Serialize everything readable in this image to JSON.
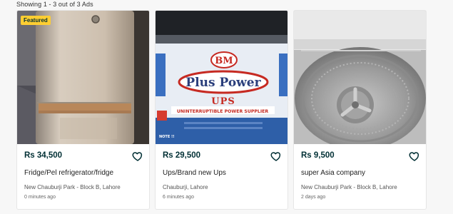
{
  "results": {
    "count_text": "Showing 1 - 3 out of 3 Ads"
  },
  "listings": [
    {
      "badge": "Featured",
      "price": "Rs 34,500",
      "title": "Fridge/Pel refrigerator/fridge",
      "location": "New Chauburji Park - Block B, Lahore",
      "posted": "0 minutes ago",
      "image": "refrigerator-photo"
    },
    {
      "price": "Rs 29,500",
      "title": "Ups/Brand new Ups",
      "location": "Chauburji, Lahore",
      "posted": "6 minutes ago",
      "image": "ups-photo",
      "image_text": {
        "brand": "BM",
        "product": "Plus Power",
        "model": "UPS",
        "tagline": "UNINTERRUPTIBLE POWER SUPPLIER",
        "note": "NOTE !!"
      }
    },
    {
      "price": "Rs 9,500",
      "title": "super Asia company",
      "location": "New Chauburji Park - Block B, Lahore",
      "posted": "2 days ago",
      "image": "washing-machine-drum-photo"
    }
  ],
  "icons": {
    "favorite": "heart-outline-icon"
  },
  "colors": {
    "badge": "#ffce32",
    "price": "#002f34"
  }
}
